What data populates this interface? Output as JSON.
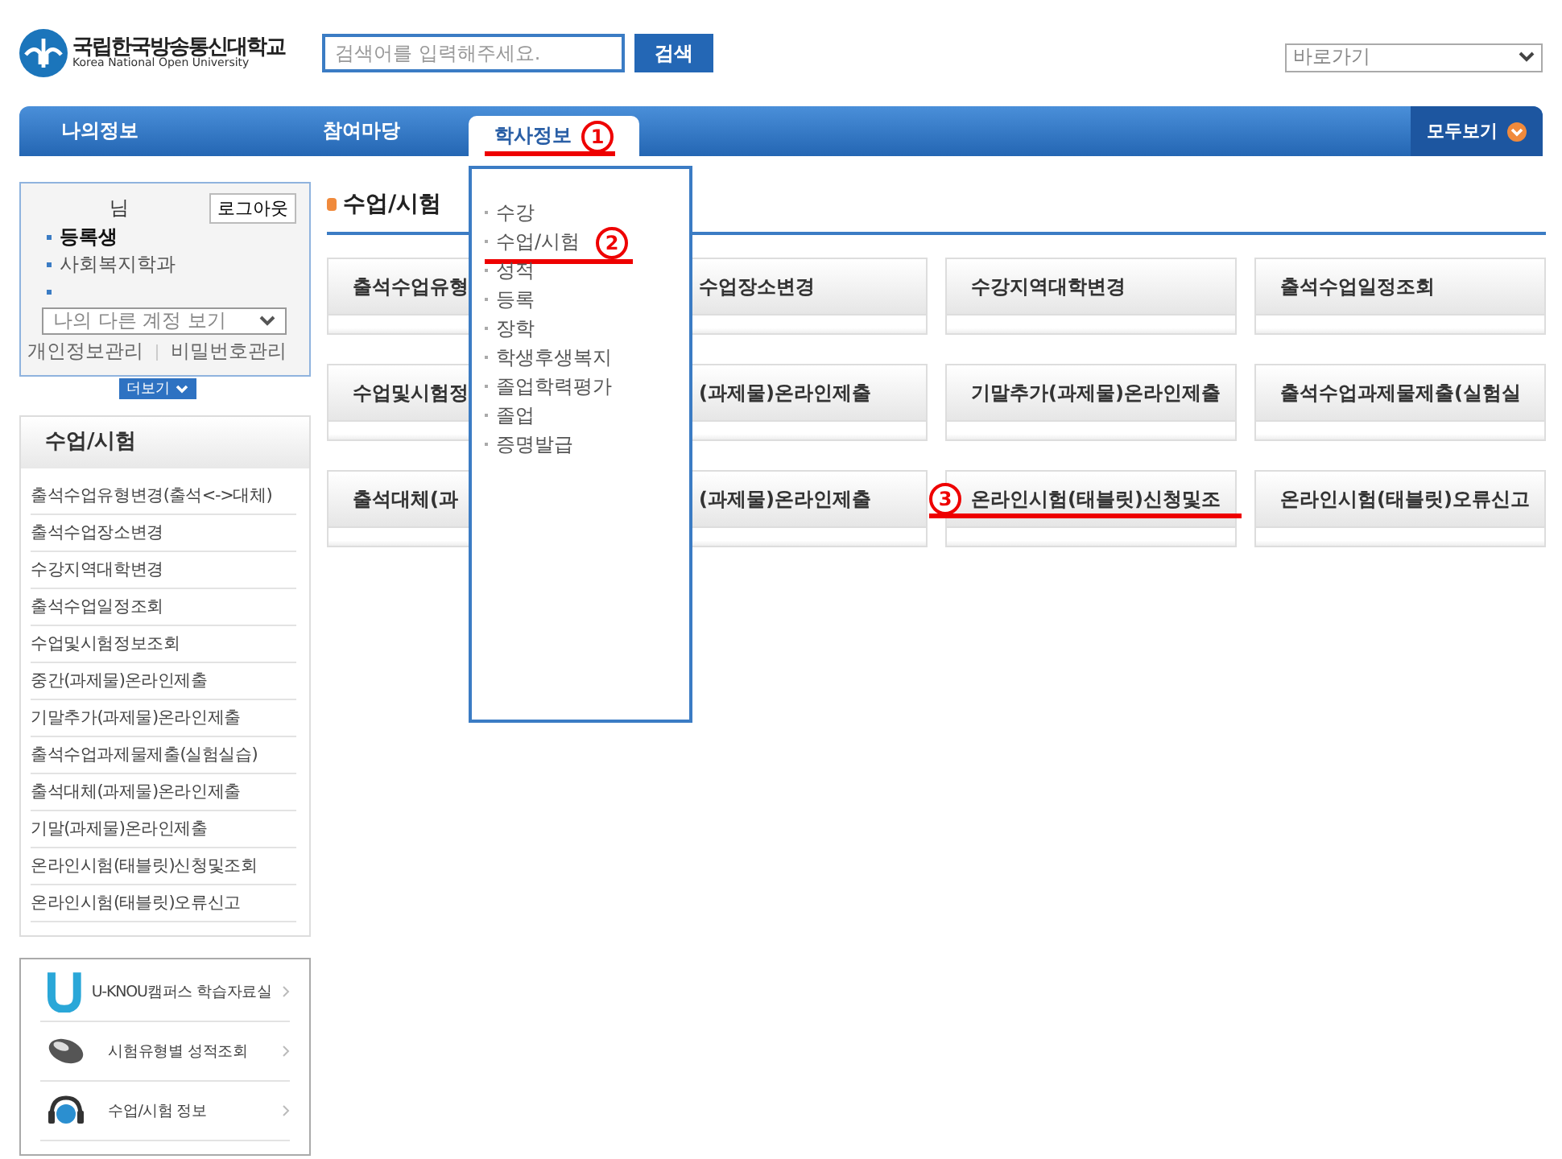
{
  "header": {
    "logo_korean": "국립한국방송통신대학교",
    "logo_english": "Korea National Open University",
    "search": {
      "placeholder": "검색어를 입력해주세요."
    },
    "search_button": "검색",
    "quick_select": "바로가기"
  },
  "nav": {
    "tabs": [
      {
        "label": "나의정보",
        "selected": false
      },
      {
        "label": "참여마당",
        "selected": false
      },
      {
        "label": "학사정보",
        "selected": true,
        "annotation": "1"
      }
    ],
    "view_all": "모두보기"
  },
  "dropdown": {
    "items": [
      {
        "label": "수강"
      },
      {
        "label": "수업/시험",
        "annotation": "2"
      },
      {
        "label": "성적"
      },
      {
        "label": "등록"
      },
      {
        "label": "장학"
      },
      {
        "label": "학생후생복지"
      },
      {
        "label": "졸업학력평가"
      },
      {
        "label": "졸업"
      },
      {
        "label": "증명발급"
      }
    ]
  },
  "login": {
    "greeting": "님",
    "logout": "로그아웃",
    "info": [
      {
        "kind": "text",
        "text": "등록생",
        "bold": true
      },
      {
        "kind": "text",
        "text": "사회복지학과",
        "bold": false
      },
      {
        "kind": "empty"
      }
    ],
    "account_select": "나의 다른 계정 보기",
    "links": [
      "개인정보관리",
      "비밀번호관리"
    ],
    "more": "더보기"
  },
  "side_menu": {
    "title": "수업/시험",
    "items": [
      "출석수업유형변경(출석<->대체)",
      "출석수업장소변경",
      "수강지역대학변경",
      "출석수업일정조회",
      "수업및시험정보조회",
      "중간(과제물)온라인제출",
      "기말추가(과제물)온라인제출",
      "출석수업과제물제출(실험실습)",
      "출석대체(과제물)온라인제출",
      "기말(과제물)온라인제출",
      "온라인시험(태블릿)신청및조회",
      "온라인시험(태블릿)오류신고"
    ]
  },
  "quick_links": [
    {
      "label": "U-KNOU캠퍼스 학습자료실",
      "kind": "u"
    },
    {
      "label": "시험유형별 성적조회",
      "kind": "mouse"
    },
    {
      "label": "수업/시험 정보",
      "kind": "headset"
    }
  ],
  "content": {
    "title": "수업/시험",
    "cards": [
      {
        "label": "출석수업유형"
      },
      {
        "label": "수업장소변경"
      },
      {
        "label": "수강지역대학변경"
      },
      {
        "label": "출석수업일정조회"
      },
      {
        "label": "수업및시험정"
      },
      {
        "label": "(과제물)온라인제출"
      },
      {
        "label": "기말추가(과제물)온라인제출"
      },
      {
        "label": "출석수업과제물제출(실험실"
      },
      {
        "label": "출석대체(과"
      },
      {
        "label": "(과제물)온라인제출"
      },
      {
        "label": "온라인시험(태블릿)신청및조",
        "annotation": "3"
      },
      {
        "label": "온라인시험(태블릿)오류신고"
      }
    ]
  }
}
